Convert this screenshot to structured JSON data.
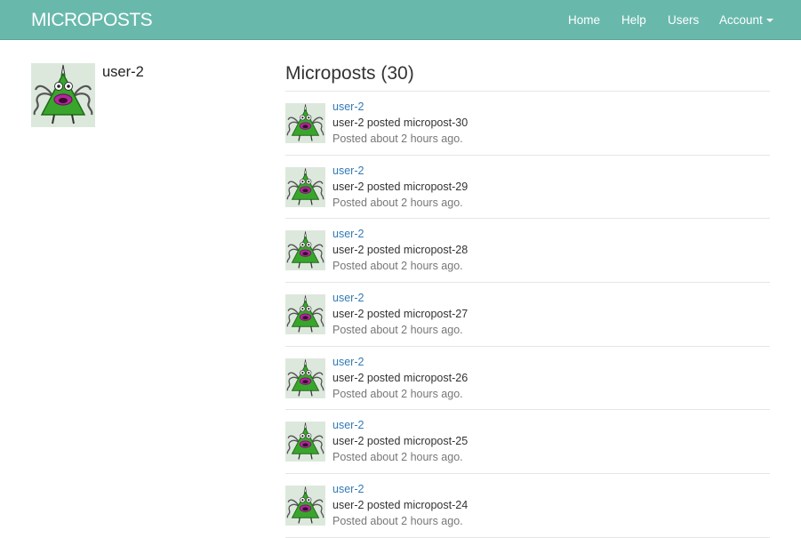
{
  "navbar": {
    "brand": "MICROPOSTS",
    "links": {
      "home": "Home",
      "help": "Help",
      "users": "Users",
      "account": "Account"
    }
  },
  "profile": {
    "username": "user-2",
    "avatar_icon": "monster-avatar-icon"
  },
  "feed": {
    "title": "Microposts (30)",
    "posts": [
      {
        "user": "user-2",
        "content": "user-2 posted micropost-30",
        "time": "Posted about 2 hours ago."
      },
      {
        "user": "user-2",
        "content": "user-2 posted micropost-29",
        "time": "Posted about 2 hours ago."
      },
      {
        "user": "user-2",
        "content": "user-2 posted micropost-28",
        "time": "Posted about 2 hours ago."
      },
      {
        "user": "user-2",
        "content": "user-2 posted micropost-27",
        "time": "Posted about 2 hours ago."
      },
      {
        "user": "user-2",
        "content": "user-2 posted micropost-26",
        "time": "Posted about 2 hours ago."
      },
      {
        "user": "user-2",
        "content": "user-2 posted micropost-25",
        "time": "Posted about 2 hours ago."
      },
      {
        "user": "user-2",
        "content": "user-2 posted micropost-24",
        "time": "Posted about 2 hours ago."
      }
    ]
  },
  "colors": {
    "navbar": "#68b9ac",
    "link": "#337ab7",
    "muted": "#777777",
    "avatar_bg": "#dde8dd",
    "monster_green": "#3aa52d",
    "monster_mouth": "#b0289a"
  }
}
